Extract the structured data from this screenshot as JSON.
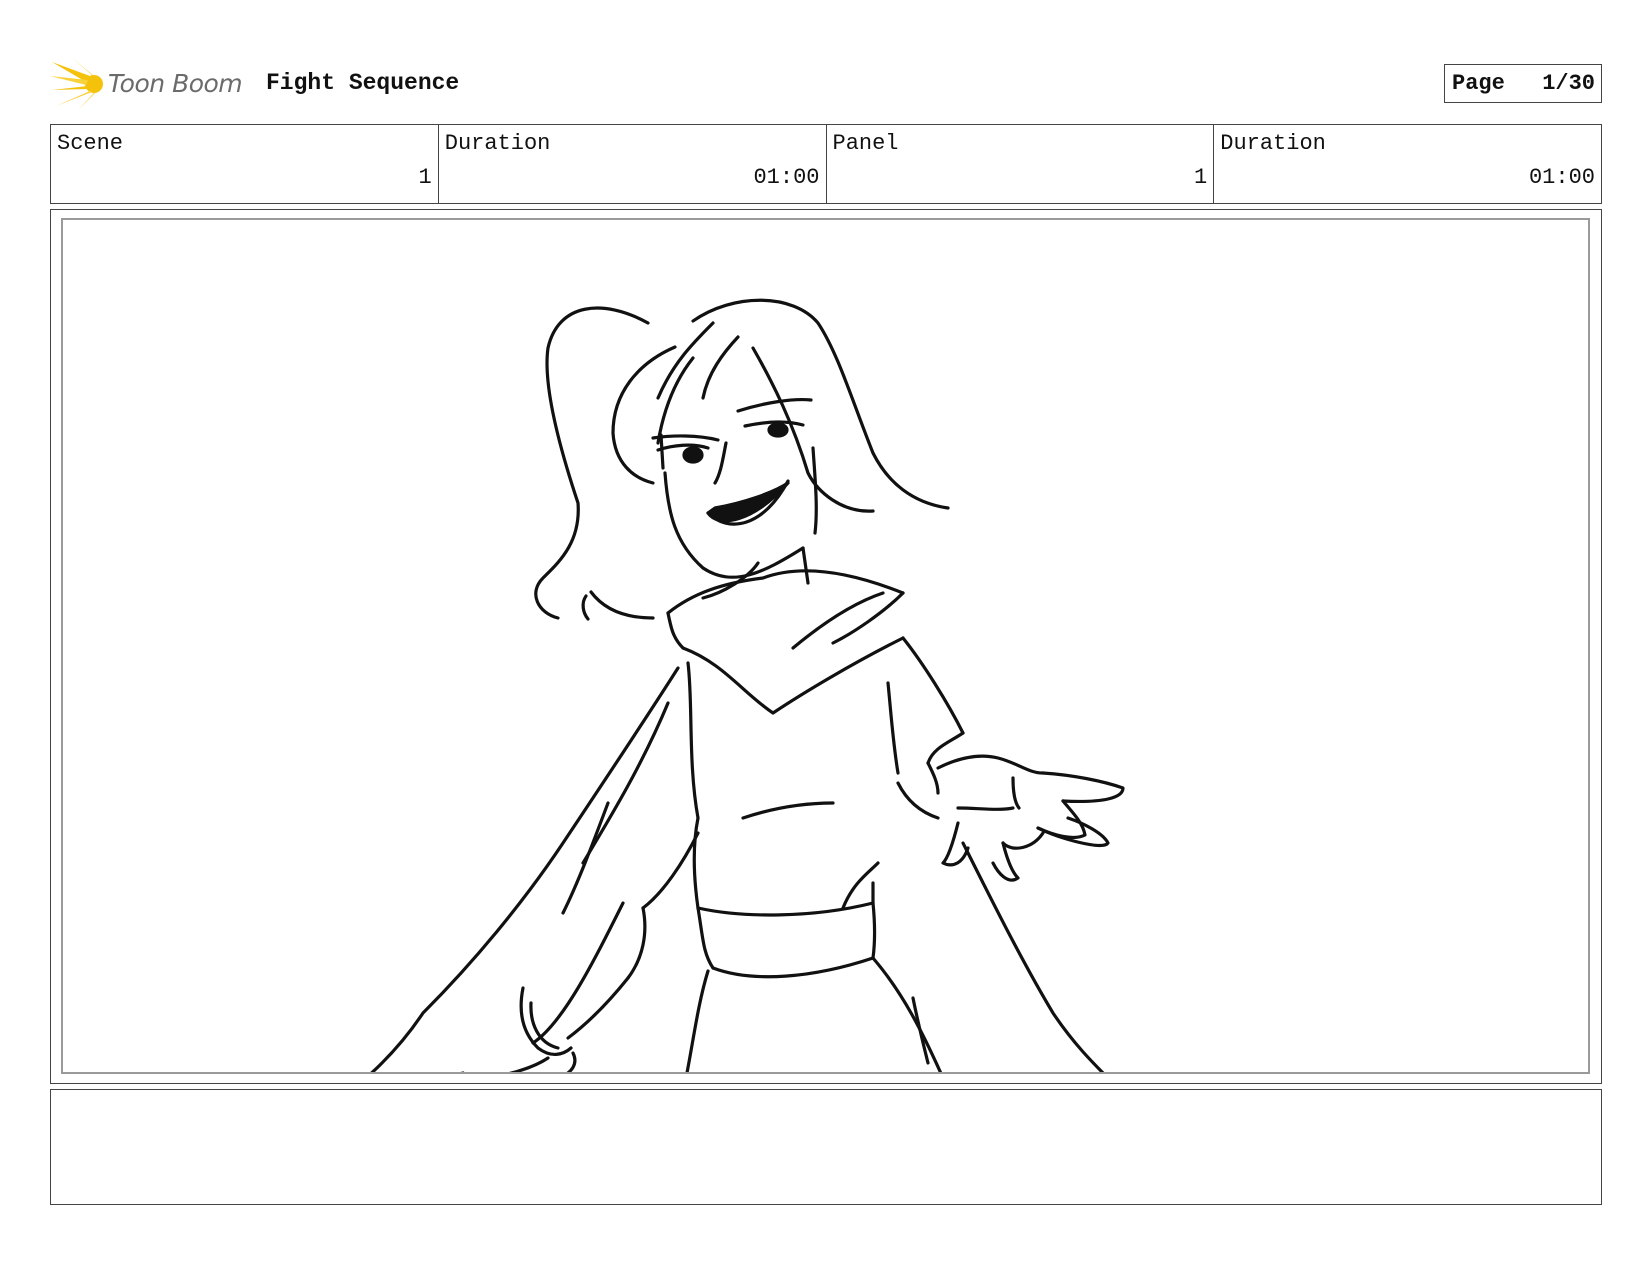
{
  "header": {
    "logo_text": "Toon Boom",
    "logo_icon": "starburst-icon",
    "title": "Fight Sequence",
    "page_label": "Page",
    "page_value": "1/30"
  },
  "info": {
    "scene_label": "Scene",
    "scene_value": "1",
    "scene_duration_label": "Duration",
    "scene_duration_value": "01:00",
    "panel_label": "Panel",
    "panel_value": "1",
    "panel_duration_label": "Duration",
    "panel_duration_value": "01:00"
  },
  "colors": {
    "logo_yellow": "#F5C20B",
    "logo_text_gray": "#6B6B6B",
    "frame_border": "#444444"
  }
}
